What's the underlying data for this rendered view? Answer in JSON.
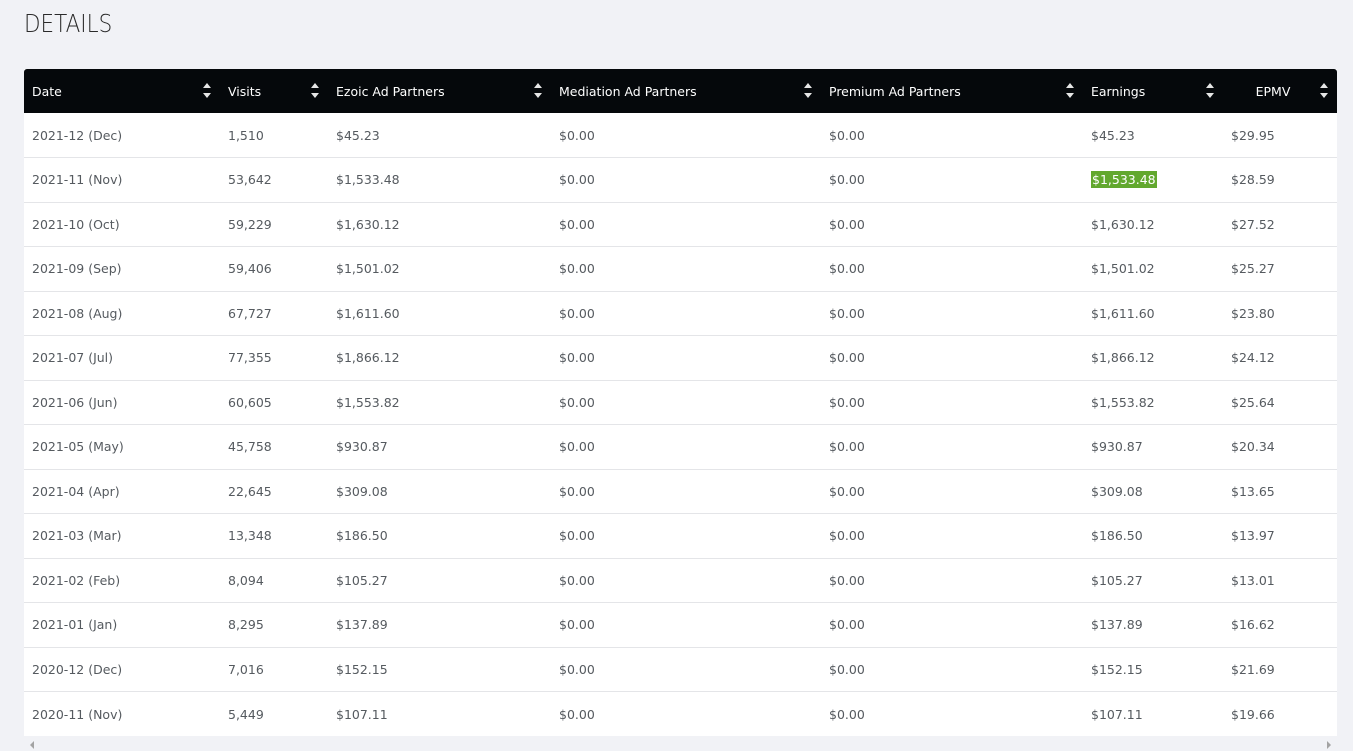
{
  "page": {
    "title": "DETAILS"
  },
  "table": {
    "columns": [
      {
        "key": "date",
        "label": "Date"
      },
      {
        "key": "visits",
        "label": "Visits"
      },
      {
        "key": "ezoic",
        "label": "Ezoic Ad Partners"
      },
      {
        "key": "mediation",
        "label": "Mediation Ad Partners"
      },
      {
        "key": "premium",
        "label": "Premium Ad Partners"
      },
      {
        "key": "earnings",
        "label": "Earnings"
      },
      {
        "key": "epmv",
        "label": "EPMV"
      }
    ],
    "highlight_color": "#62a82e",
    "header_background": "#05080b",
    "rows": [
      {
        "date": "2021-12 (Dec)",
        "visits": "1,510",
        "ezoic": "$45.23",
        "mediation": "$0.00",
        "premium": "$0.00",
        "earnings": "$45.23",
        "epmv": "$29.95",
        "earnings_highlighted": false
      },
      {
        "date": "2021-11 (Nov)",
        "visits": "53,642",
        "ezoic": "$1,533.48",
        "mediation": "$0.00",
        "premium": "$0.00",
        "earnings": "$1,533.48",
        "epmv": "$28.59",
        "earnings_highlighted": true
      },
      {
        "date": "2021-10 (Oct)",
        "visits": "59,229",
        "ezoic": "$1,630.12",
        "mediation": "$0.00",
        "premium": "$0.00",
        "earnings": "$1,630.12",
        "epmv": "$27.52",
        "earnings_highlighted": false
      },
      {
        "date": "2021-09 (Sep)",
        "visits": "59,406",
        "ezoic": "$1,501.02",
        "mediation": "$0.00",
        "premium": "$0.00",
        "earnings": "$1,501.02",
        "epmv": "$25.27",
        "earnings_highlighted": false
      },
      {
        "date": "2021-08 (Aug)",
        "visits": "67,727",
        "ezoic": "$1,611.60",
        "mediation": "$0.00",
        "premium": "$0.00",
        "earnings": "$1,611.60",
        "epmv": "$23.80",
        "earnings_highlighted": false
      },
      {
        "date": "2021-07 (Jul)",
        "visits": "77,355",
        "ezoic": "$1,866.12",
        "mediation": "$0.00",
        "premium": "$0.00",
        "earnings": "$1,866.12",
        "epmv": "$24.12",
        "earnings_highlighted": false
      },
      {
        "date": "2021-06 (Jun)",
        "visits": "60,605",
        "ezoic": "$1,553.82",
        "mediation": "$0.00",
        "premium": "$0.00",
        "earnings": "$1,553.82",
        "epmv": "$25.64",
        "earnings_highlighted": false
      },
      {
        "date": "2021-05 (May)",
        "visits": "45,758",
        "ezoic": "$930.87",
        "mediation": "$0.00",
        "premium": "$0.00",
        "earnings": "$930.87",
        "epmv": "$20.34",
        "earnings_highlighted": false
      },
      {
        "date": "2021-04 (Apr)",
        "visits": "22,645",
        "ezoic": "$309.08",
        "mediation": "$0.00",
        "premium": "$0.00",
        "earnings": "$309.08",
        "epmv": "$13.65",
        "earnings_highlighted": false
      },
      {
        "date": "2021-03 (Mar)",
        "visits": "13,348",
        "ezoic": "$186.50",
        "mediation": "$0.00",
        "premium": "$0.00",
        "earnings": "$186.50",
        "epmv": "$13.97",
        "earnings_highlighted": false
      },
      {
        "date": "2021-02 (Feb)",
        "visits": "8,094",
        "ezoic": "$105.27",
        "mediation": "$0.00",
        "premium": "$0.00",
        "earnings": "$105.27",
        "epmv": "$13.01",
        "earnings_highlighted": false
      },
      {
        "date": "2021-01 (Jan)",
        "visits": "8,295",
        "ezoic": "$137.89",
        "mediation": "$0.00",
        "premium": "$0.00",
        "earnings": "$137.89",
        "epmv": "$16.62",
        "earnings_highlighted": false
      },
      {
        "date": "2020-12 (Dec)",
        "visits": "7,016",
        "ezoic": "$152.15",
        "mediation": "$0.00",
        "premium": "$0.00",
        "earnings": "$152.15",
        "epmv": "$21.69",
        "earnings_highlighted": false
      },
      {
        "date": "2020-11 (Nov)",
        "visits": "5,449",
        "ezoic": "$107.11",
        "mediation": "$0.00",
        "premium": "$0.00",
        "earnings": "$107.11",
        "epmv": "$19.66",
        "earnings_highlighted": false
      }
    ]
  },
  "icons": {
    "sort": "sort-up-down-icon",
    "scroll_left": "scroll-left-arrow-icon",
    "scroll_right": "scroll-right-arrow-icon"
  }
}
